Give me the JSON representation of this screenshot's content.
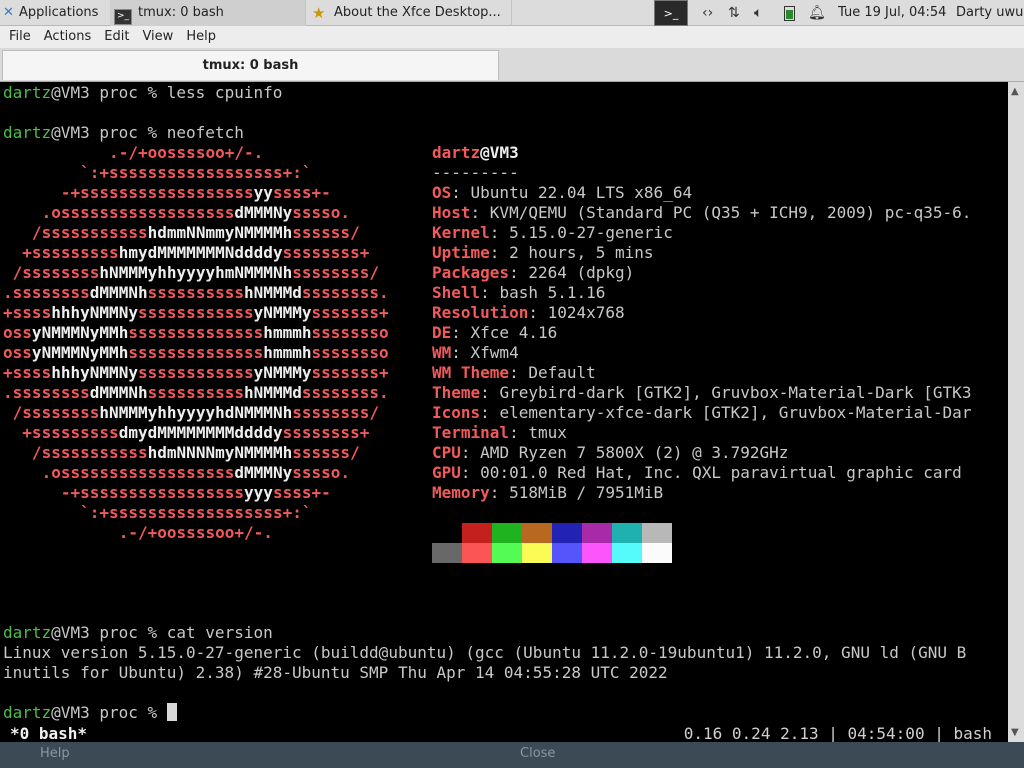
{
  "panel": {
    "applications": "Applications",
    "task1": "tmux: 0 bash",
    "task2": "About the Xfce Desktop...",
    "clock": "Tue 19 Jul, 04:54",
    "user": "Darty uwu",
    "icons": [
      "network-icon",
      "arrows-icon",
      "volume-icon",
      "battery-icon",
      "bell-icon"
    ]
  },
  "menu": {
    "file": "File",
    "actions": "Actions",
    "edit": "Edit",
    "view": "View",
    "help": "Help"
  },
  "tab": {
    "title": "tmux: 0 bash"
  },
  "terminal": {
    "user": "dartz",
    "host_prompt": "@VM3 proc % ",
    "cmd1": "less cpuinfo",
    "cmd2": "neofetch",
    "cmd3": "cat version",
    "version_line1": "Linux version 5.15.0-27-generic (buildd@ubuntu) (gcc (Ubuntu 11.2.0-19ubuntu1) 11.2.0, GNU ld (GNU B",
    "version_line2": "inutils for Ubuntu) 2.38) #28-Ubuntu SMP Thu Apr 14 04:55:28 UTC 2022",
    "logo": [
      "           .-/+oossssoo+/-.",
      "        `:+ssssssssssssssssss+:`",
      "      -+ssssssssssssssssssyyssss+-",
      "    .ossssssssssssssssssdMMMNysssso.",
      "   /ssssssssssshdmmNNmmyNMMMMhssssss/",
      "  +ssssssssshmydMMMMMMMNddddyssssssss+",
      " /sssssssshNMMMyhhyyyyhmNMMMNhssssssss/",
      ".ssssssssdMMMNhsssssssssshNMMMdssssssss.",
      "+sssshhhyNMMNyssssssssssssyNMMMysssssss+",
      "ossyNMMMNyMMhsssssssssssssshmmmhssssssso",
      "ossyNMMMNyMMhsssssssssssssshmmmhssssssso",
      "+sssshhhyNMMNyssssssssssssyNMMMysssssss+",
      ".ssssssssdMMMNhsssssssssshNMMMdssssssss.",
      " /sssssssshNMMMyhhyyyyhdNMMMNhssssssss/",
      "  +sssssssssdmydMMMMMMMMddddyssssssss+",
      "   /ssssssssssshdmNNNNmyNMMMMhssssss/",
      "    .ossssssssssssssssssdMMMNysssso.",
      "      -+sssssssssssssssssyyyssss+-",
      "        `:+ssssssssssssssssss+:`",
      "            .-/+oossssoo+/-."
    ],
    "info_title_user": "dartz",
    "info_title_host": "@VM3",
    "info_sep": "---------",
    "info": [
      {
        "k": "OS",
        "v": "Ubuntu 22.04 LTS x86_64"
      },
      {
        "k": "Host",
        "v": "KVM/QEMU (Standard PC (Q35 + ICH9, 2009) pc-q35-6."
      },
      {
        "k": "Kernel",
        "v": "5.15.0-27-generic"
      },
      {
        "k": "Uptime",
        "v": "2 hours, 5 mins"
      },
      {
        "k": "Packages",
        "v": "2264 (dpkg)"
      },
      {
        "k": "Shell",
        "v": "bash 5.1.16"
      },
      {
        "k": "Resolution",
        "v": "1024x768"
      },
      {
        "k": "DE",
        "v": "Xfce 4.16"
      },
      {
        "k": "WM",
        "v": "Xfwm4"
      },
      {
        "k": "WM Theme",
        "v": "Default"
      },
      {
        "k": "Theme",
        "v": "Greybird-dark [GTK2], Gruvbox-Material-Dark [GTK3"
      },
      {
        "k": "Icons",
        "v": "elementary-xfce-dark [GTK2], Gruvbox-Material-Dar"
      },
      {
        "k": "Terminal",
        "v": "tmux"
      },
      {
        "k": "CPU",
        "v": "AMD Ryzen 7 5800X (2) @ 3.792GHz"
      },
      {
        "k": "GPU",
        "v": "00:01.0 Red Hat, Inc. QXL paravirtual graphic card"
      },
      {
        "k": "Memory",
        "v": "518MiB / 7951MiB"
      }
    ],
    "palette_row1": [
      "#000000",
      "#c4201e",
      "#1fb41f",
      "#b8691f",
      "#2222b4",
      "#a82aa8",
      "#1fb0b0",
      "#b8b8b8"
    ],
    "palette_row2": [
      "#686868",
      "#fb5555",
      "#55fb55",
      "#fbfb55",
      "#5555fb",
      "#fb55fb",
      "#55fbfb",
      "#fbfbfb"
    ]
  },
  "status": {
    "left": "*0 bash*",
    "right": "0.16 0.24 2.13 | 04:54:00 | bash"
  },
  "bottom": {
    "help": "Help",
    "close": "Close"
  }
}
